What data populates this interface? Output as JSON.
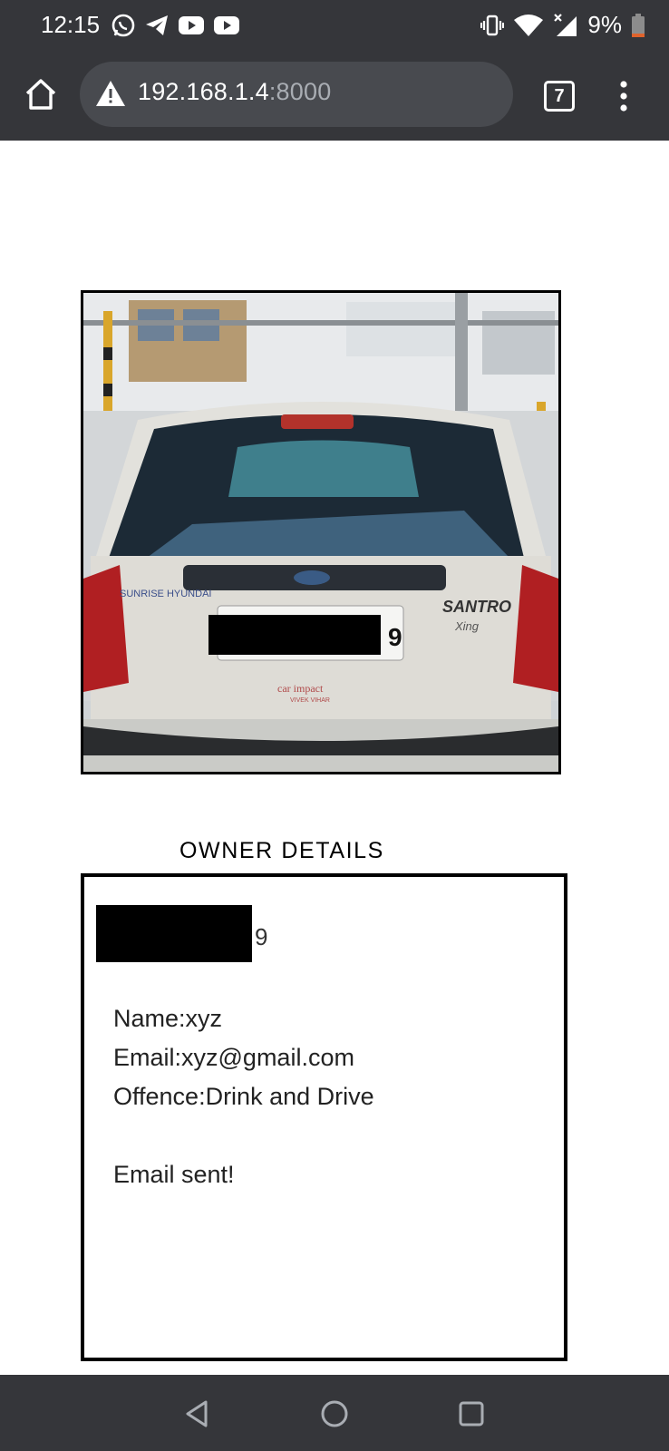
{
  "status_bar": {
    "time": "12:15",
    "app_icons": [
      "whatsapp-icon",
      "telegram-icon",
      "youtube-icon",
      "youtube-icon"
    ],
    "battery_percent": "9%"
  },
  "browser": {
    "url_host": "192.168.1.4",
    "url_port": ":8000",
    "tab_count": "7"
  },
  "page": {
    "section_title": "OWNER DETAILS",
    "plate_visible_suffix": "9",
    "name_line": "Name:xyz",
    "email_line": "Email:xyz@gmail.com",
    "offence_line": "Offence:Drink and Drive",
    "status_line": "Email sent!"
  },
  "car_photo": {
    "brand_badge": "SUNRISE HYUNDAI",
    "model_badge": "SANTRO",
    "trim_badge": "Xing",
    "dealer_sticker": "car impact",
    "dealer_sticker_sub": "VIVEK VIHAR",
    "plate_suffix": "9"
  },
  "colors": {
    "chrome_dark": "#35363a",
    "omnibox": "#484a4f",
    "page_bg": "#ffffff",
    "border": "#000000"
  }
}
